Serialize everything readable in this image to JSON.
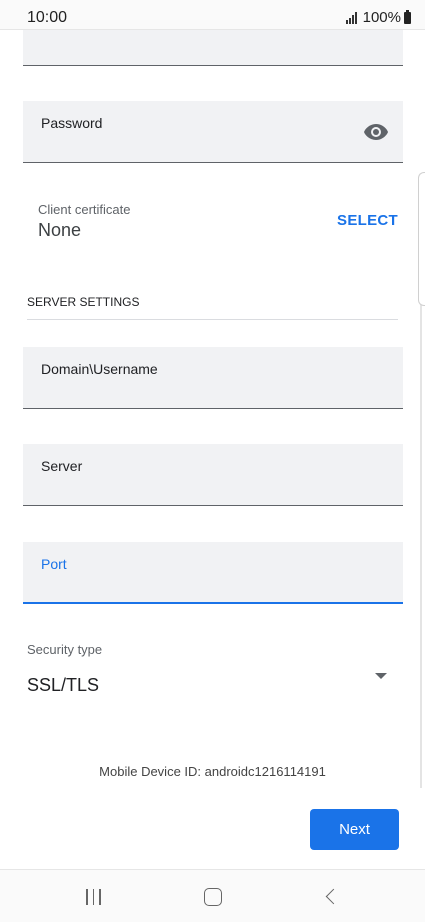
{
  "status_bar": {
    "time": "10:00",
    "battery": "100%"
  },
  "fields": {
    "password": {
      "label": "Password"
    },
    "domain_username": {
      "label": "Domain\\Username"
    },
    "server": {
      "label": "Server"
    },
    "port": {
      "label": "Port"
    }
  },
  "client_certificate": {
    "label": "Client certificate",
    "value": "None",
    "action": "SELECT"
  },
  "server_settings": {
    "title": "SERVER SETTINGS"
  },
  "security_type": {
    "label": "Security type",
    "value": "SSL/TLS"
  },
  "device_id": "Mobile Device ID: androidc1216114191",
  "actions": {
    "next_label": "Next"
  },
  "colors": {
    "accent": "#1a73e8",
    "field_bg": "#f1f2f4"
  }
}
